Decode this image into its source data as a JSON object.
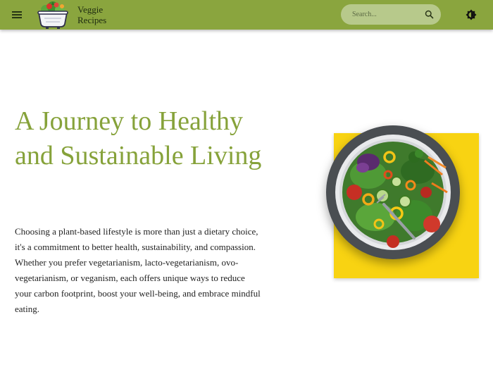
{
  "header": {
    "brand_line1": "Veggie",
    "brand_line2": "Recipes",
    "logo_icon": "salad-bowl-logo",
    "menu_icon": "menu-icon",
    "search_placeholder": "Search...",
    "search_icon": "search-icon",
    "theme_icon": "brightness-icon"
  },
  "hero": {
    "title": "A Journey to Healthy and Sustainable Living",
    "text": "Choosing a plant-based lifestyle is more than just a dietary choice, it's a commitment to better health, sustainability, and compassion. Whether you prefer vegetarianism, lacto-vegetarianism, ovo-vegetarianism, or veganism, each offers unique ways to reduce your carbon footprint, boost your well-being, and embrace mindful eating.",
    "image_icon": "salad-bowl-photo"
  },
  "colors": {
    "header_bg": "#8aa53e",
    "accent": "#86a23a",
    "yellow": "#f8d312",
    "search_bg": "#b7c98b"
  }
}
